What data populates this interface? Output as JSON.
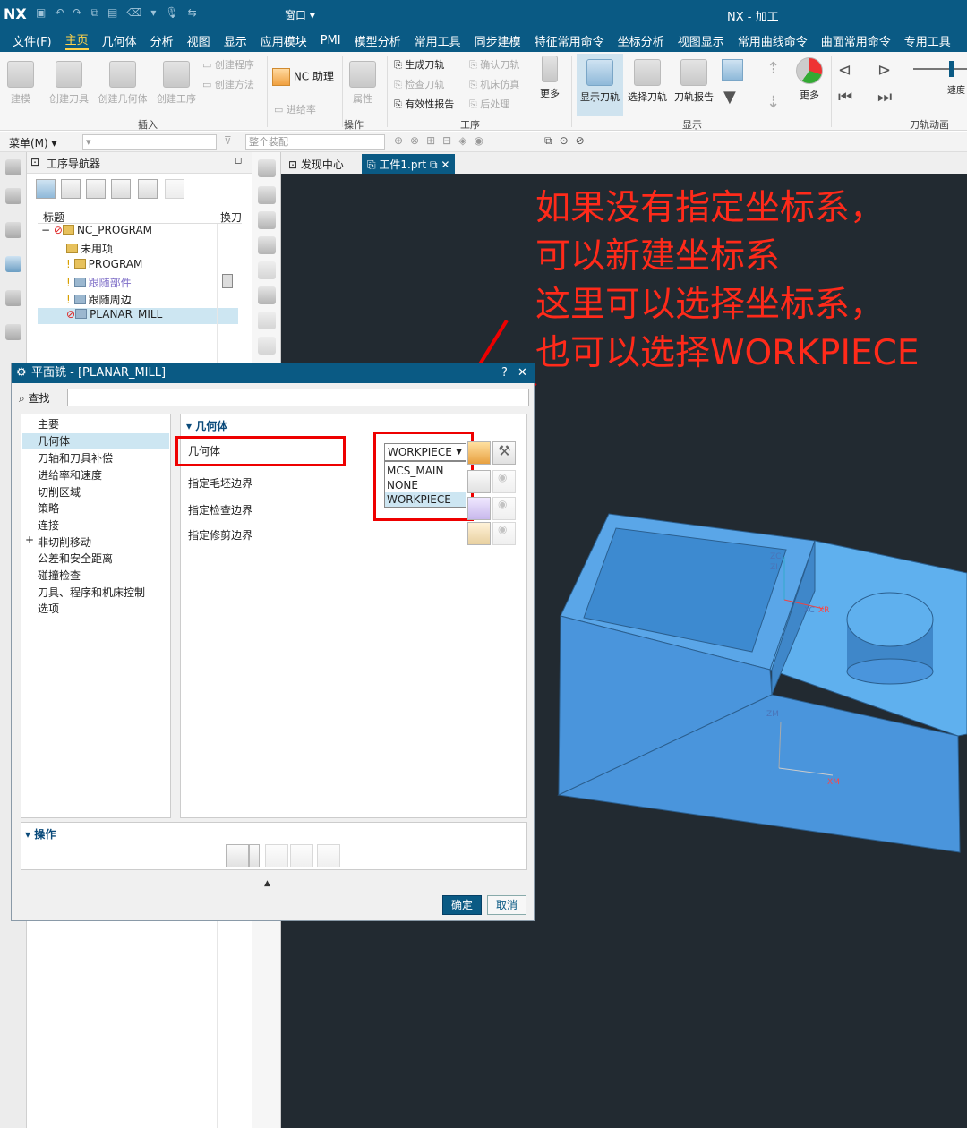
{
  "app": {
    "logo": "NX",
    "title": "NX - 加工",
    "window_menu": "窗口 ▾"
  },
  "menubar": [
    "文件(F)",
    "主页",
    "几何体",
    "分析",
    "视图",
    "显示",
    "应用模块",
    "PMI",
    "模型分析",
    "常用工具",
    "同步建模",
    "特征常用命令",
    "坐标分析",
    "视图显示",
    "常用曲线命令",
    "曲面常用命令",
    "专用工具"
  ],
  "menubar_active": "主页",
  "ribbon": {
    "insert": {
      "big": [
        "建模",
        "创建刀具",
        "创建几何体",
        "创建工序"
      ],
      "small": [
        "创建程序",
        "创建方法"
      ],
      "group": "插入"
    },
    "ncassist": "NC 助理",
    "ops": {
      "big": "属性",
      "small": "进给率",
      "group": "操作"
    },
    "process": {
      "col1": [
        "生成刀轨",
        "检查刀轨",
        "有效性报告"
      ],
      "col2": [
        "确认刀轨",
        "机床仿真",
        "后处理"
      ],
      "more": "更多",
      "group": "工序"
    },
    "display": {
      "big": [
        "显示刀轨",
        "选择刀轨",
        "刀轨报告"
      ],
      "more": "更多",
      "group": "显示"
    },
    "anim": {
      "group": "刀轨动画",
      "speed": "速度"
    }
  },
  "toolbar2": {
    "menu": "菜单(M) ▾",
    "filter": "整个装配"
  },
  "navigator": {
    "title": "工序导航器",
    "col_title": "标题",
    "col_swap": "换刀",
    "items": [
      {
        "label": "NC_PROGRAM"
      },
      {
        "label": "未用项"
      },
      {
        "label": "PROGRAM"
      },
      {
        "label": "跟随部件"
      },
      {
        "label": "跟随周边"
      },
      {
        "label": "PLANAR_MILL"
      }
    ]
  },
  "tabs": {
    "discover": "发现中心",
    "part": "工件1.prt"
  },
  "annotation": [
    "如果没有指定坐标系，",
    "可以新建坐标系",
    "这里可以选择坐标系，",
    "也可以选择WORKPIECE"
  ],
  "dialog": {
    "title": "平面铣 - [PLANAR_MILL]",
    "help": "?",
    "close": "✕",
    "find_label": "查找",
    "find_value": "",
    "categories": [
      "主要",
      "几何体",
      "刀轴和刀具补偿",
      "进给率和速度",
      "切削区域",
      "策略",
      "连接",
      "非切削移动",
      "公差和安全距离",
      "碰撞检查",
      "刀具、程序和机床控制",
      "选项"
    ],
    "selected_category": "几何体",
    "expand_marker": "+",
    "section": "几何体",
    "geometry_label": "几何体",
    "geometry_value": "WORKPIECE",
    "geometry_options": [
      "MCS_MAIN",
      "NONE",
      "WORKPIECE"
    ],
    "rows": [
      "指定毛坯边界",
      "指定检查边界",
      "指定修剪边界"
    ],
    "ops_section": "操作",
    "ok": "确定",
    "cancel": "取消"
  },
  "axes": {
    "zm": "ZM",
    "xm": "XM",
    "zc": "ZC",
    "zi": "ZI",
    "xc": "XC",
    "xr": "XR"
  }
}
